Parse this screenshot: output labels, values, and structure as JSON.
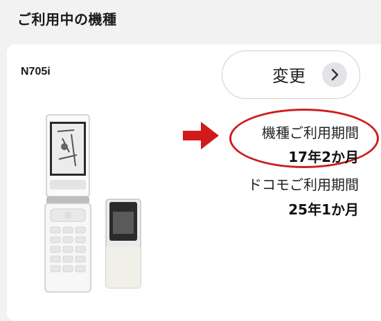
{
  "section": {
    "title": "ご利用中の機種"
  },
  "device": {
    "model": "N705i",
    "change_button": {
      "label": "変更",
      "icon": "chevron-right-icon"
    }
  },
  "usage": {
    "device_period_label": "機種ご利用期間",
    "device_period_value": "17年2か月",
    "docomo_period_label": "ドコモご利用期間",
    "docomo_period_value": "25年1か月"
  },
  "annotation": {
    "highlight_color": "#cc1f1f",
    "arrow": "right-arrow-icon"
  }
}
